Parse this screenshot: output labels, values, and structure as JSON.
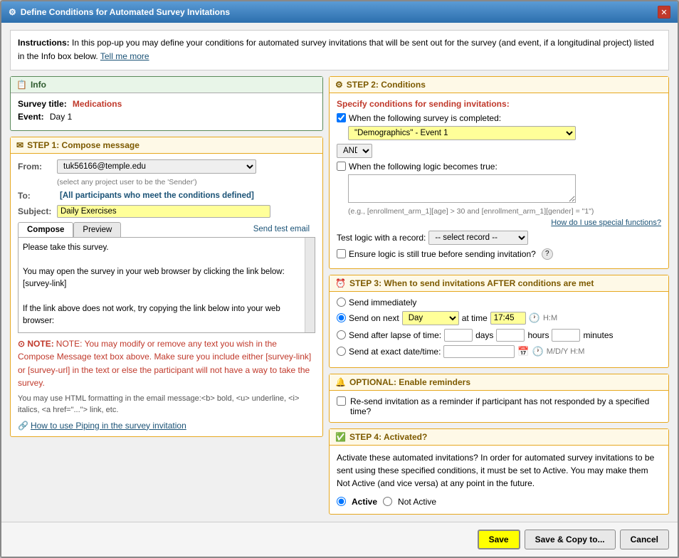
{
  "dialog": {
    "title": "Define Conditions for Automated Survey Invitations",
    "close_label": "✕"
  },
  "instructions": {
    "text": "Instructions: In this pop-up you may define your conditions for automated survey invitations that will be sent out for the survey (and event, if a longitudinal project) listed in the Info box below.",
    "link": "Tell me more"
  },
  "info": {
    "header": "Info",
    "survey_title_label": "Survey title:",
    "survey_title_value": "Medications",
    "event_label": "Event:",
    "event_value": "Day 1"
  },
  "step1": {
    "header": "STEP 1: Compose message",
    "from_label": "From:",
    "from_value": "tuk56166@temple.edu",
    "from_hint": "(select any project user to be the 'Sender')",
    "to_label": "To:",
    "to_value": "[All participants who meet the conditions defined]",
    "subject_label": "Subject:",
    "subject_value": "Daily Exercises",
    "tab_compose": "Compose",
    "tab_preview": "Preview",
    "send_test": "Send test email",
    "compose_text": "Please take this survey.\n\nYou may open the survey in your web browser by clicking the link below:\n[survey-link]\n\nIf the link above does not work, try copying the link below into your web browser:",
    "note": "NOTE: You may modify or remove any text you wish in the Compose Message text box above. Make sure you include either [survey-link] or [survey-url] in the text or else the participant will not have a way to take the survey.",
    "note2": "You may use HTML formatting in the email message:<b> bold, <u> underline, <i> italics, <a href=\"...\"> link, etc.",
    "piping_link": "How to use Piping in the survey invitation"
  },
  "step2": {
    "header": "STEP 2: Conditions",
    "specify_label": "Specify conditions for sending invitations:",
    "survey_checkbox_label": "When the following survey is completed:",
    "survey_value": "\"Demographics\" - Event 1",
    "and_label": "AND",
    "logic_checkbox_label": "When the following logic becomes true:",
    "logic_hint": "(e.g., [enrollment_arm_1][age] > 30 and [enrollment_arm_1][gender] = \"1\")",
    "special_functions_link": "How do I use special functions?",
    "test_logic_label": "Test logic with a record:",
    "select_record_label": "-- select record --",
    "ensure_checkbox_label": "Ensure logic is still true before sending invitation?",
    "help_icon": "?"
  },
  "step3": {
    "header": "STEP 3: When to send invitations AFTER conditions are met",
    "send_immediately_label": "Send immediately",
    "send_on_next_label": "Send on next",
    "day_value": "Day",
    "at_time_label": "at time",
    "time_value": "17:45",
    "hm_label": "H:M",
    "send_after_label": "Send after lapse of time:",
    "days_label": "days",
    "hours_label": "hours",
    "minutes_label": "minutes",
    "send_exact_label": "Send at exact date/time:",
    "mdy_label": "M/D/Y H:M"
  },
  "optional": {
    "header": "OPTIONAL: Enable reminders",
    "reminder_label": "Re-send invitation as a reminder if participant has not responded by a specified time?"
  },
  "step4": {
    "header": "STEP 4: Activated?",
    "desc": "Activate these automated invitations? In order for automated survey invitations to be sent using these specified conditions, it must be set to Active. You may make them Not Active (and vice versa) at any point in the future.",
    "active_label": "Active",
    "not_active_label": "Not Active"
  },
  "footer": {
    "save_label": "Save",
    "save_copy_label": "Save & Copy to...",
    "cancel_label": "Cancel"
  }
}
